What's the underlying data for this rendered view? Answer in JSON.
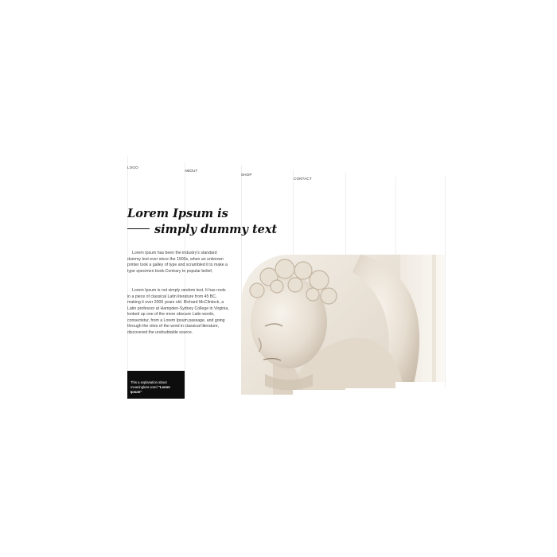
{
  "nav": {
    "logo": "LOGO",
    "about": "ABOUT",
    "shop": "SHOP",
    "contact": "CONTACT"
  },
  "hero": {
    "heading_line1": "Lorem Ipsum is",
    "heading_line2": "simply dummy text",
    "paragraph1": "Lorem Ipsum has been the industry's standard dummy text ever since the 1500s, when an unknown printer took a galley of type and scrambled it to make a type specimen book.Contrary to popular belief,",
    "paragraph2": "Lorem Ipsum is not simply random text. It has roots in a piece of classical Latin literature from 45 BC, making it over 2000 years old. Richard McClintock, a Latin professor at Hampden-Sydney College in Virginia, looked up one of the more obscure Latin words, consectetur, from a Lorem Ipsum passage, and going through the cites of the word in classical literature, discovered the undoubtable source."
  },
  "caption": {
    "text": "This a explanation about meaningless word ",
    "emphasis": "\"Lorem Ipsum\""
  },
  "image": {
    "subject": "marble-statue-photo"
  },
  "colors": {
    "background": "#ffffff",
    "text": "#111111",
    "caption_bg": "#0d0d0d",
    "marble": "#e9e2d7"
  }
}
